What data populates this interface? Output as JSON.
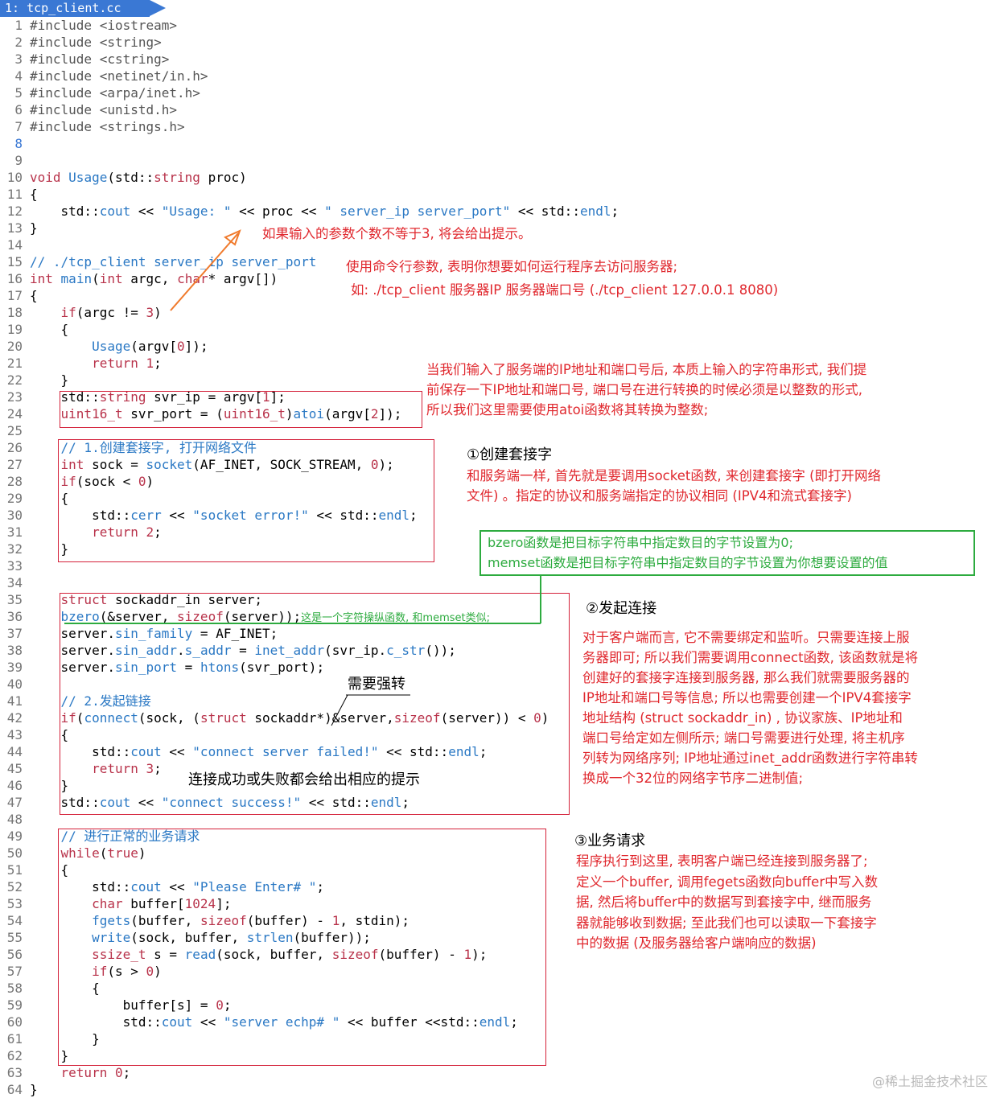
{
  "tab": {
    "label": "1: tcp_client.cc"
  },
  "code_lines": [
    {
      "n": "1",
      "html": "<span class='pp'>#include &lt;iostream&gt;</span>"
    },
    {
      "n": "2",
      "html": "<span class='pp'>#include &lt;string&gt;</span>"
    },
    {
      "n": "3",
      "html": "<span class='pp'>#include &lt;cstring&gt;</span>"
    },
    {
      "n": "4",
      "html": "<span class='pp'>#include &lt;netinet/in.h&gt;</span>"
    },
    {
      "n": "5",
      "html": "<span class='pp'>#include &lt;arpa/inet.h&gt;</span>"
    },
    {
      "n": "6",
      "html": "<span class='pp'>#include &lt;unistd.h&gt;</span>"
    },
    {
      "n": "7",
      "html": "<span class='pp'>#include &lt;strings.h&gt;</span>"
    },
    {
      "n": "8",
      "html": "",
      "current": true
    },
    {
      "n": "9",
      "html": ""
    },
    {
      "n": "10",
      "html": "<span class='ty'>void</span> <span class='fn'>Usage</span>(std::<span class='ty'>string</span> proc)"
    },
    {
      "n": "11",
      "html": "{"
    },
    {
      "n": "12",
      "html": "    std::<span class='fn'>cout</span> &lt;&lt; <span class='str'>\"Usage: \"</span> &lt;&lt; proc &lt;&lt; <span class='str'>\" server_ip server_port\"</span> &lt;&lt; std::<span class='fn'>endl</span>;"
    },
    {
      "n": "13",
      "html": "}"
    },
    {
      "n": "14",
      "html": ""
    },
    {
      "n": "15",
      "html": "<span class='cm'>// ./tcp_client server_ip server_port</span>"
    },
    {
      "n": "16",
      "html": "<span class='ty'>int</span> <span class='fn'>main</span>(<span class='ty'>int</span> argc, <span class='ty'>char</span>* argv[])"
    },
    {
      "n": "17",
      "html": "{"
    },
    {
      "n": "18",
      "html": "    <span class='kw'>if</span>(argc != <span class='num'>3</span>)"
    },
    {
      "n": "19",
      "html": "    {"
    },
    {
      "n": "20",
      "html": "        <span class='fn'>Usage</span>(argv[<span class='num'>0</span>]);"
    },
    {
      "n": "21",
      "html": "        <span class='kw'>return</span> <span class='num'>1</span>;"
    },
    {
      "n": "22",
      "html": "    }"
    },
    {
      "n": "23",
      "html": "    std::<span class='ty'>string</span> svr_ip = argv[<span class='num'>1</span>];"
    },
    {
      "n": "24",
      "html": "    <span class='ty'>uint16_t</span> svr_port = (<span class='ty'>uint16_t</span>)<span class='fn'>atoi</span>(argv[<span class='num'>2</span>]);"
    },
    {
      "n": "25",
      "html": ""
    },
    {
      "n": "26",
      "html": "    <span class='cm'>// 1.创建套接字, 打开网络文件</span>"
    },
    {
      "n": "27",
      "html": "    <span class='ty'>int</span> sock = <span class='fn'>socket</span>(AF_INET, SOCK_STREAM, <span class='num'>0</span>);"
    },
    {
      "n": "28",
      "html": "    <span class='kw'>if</span>(sock &lt; <span class='num'>0</span>)"
    },
    {
      "n": "29",
      "html": "    {"
    },
    {
      "n": "30",
      "html": "        std::<span class='fn'>cerr</span> &lt;&lt; <span class='str'>\"socket error!\"</span> &lt;&lt; std::<span class='fn'>endl</span>;"
    },
    {
      "n": "31",
      "html": "        <span class='kw'>return</span> <span class='num'>2</span>;"
    },
    {
      "n": "32",
      "html": "    }"
    },
    {
      "n": "33",
      "html": ""
    },
    {
      "n": "34",
      "html": ""
    },
    {
      "n": "35",
      "html": "    <span class='kw'>struct</span> sockaddr_in server;"
    },
    {
      "n": "36",
      "html": "    <span class='fn'>bzero</span>(&amp;server, <span class='kw'>sizeof</span>(server));<span class='note-green-inline' style='color:#2dab3f;font-family:\"DejaVu Sans\",sans-serif;font-size:13px;'>这是一个字符操纵函数, 和memset类似;</span>"
    },
    {
      "n": "37",
      "html": "    server.<span class='fn'>sin_family</span> = AF_INET;"
    },
    {
      "n": "38",
      "html": "    server.<span class='fn'>sin_addr</span>.<span class='fn'>s_addr</span> = <span class='fn'>inet_addr</span>(svr_ip.<span class='fn'>c_str</span>());"
    },
    {
      "n": "39",
      "html": "    server.<span class='fn'>sin_port</span> = <span class='fn'>htons</span>(svr_port);"
    },
    {
      "n": "40",
      "html": ""
    },
    {
      "n": "41",
      "html": "    <span class='cm'>// 2.发起链接</span>"
    },
    {
      "n": "42",
      "html": "    <span class='kw'>if</span>(<span class='fn'>connect</span>(sock, (<span class='kw'>struct</span> sockaddr*)&amp;server,<span class='kw'>sizeof</span>(server)) &lt; <span class='num'>0</span>)"
    },
    {
      "n": "43",
      "html": "    {"
    },
    {
      "n": "44",
      "html": "        std::<span class='fn'>cout</span> &lt;&lt; <span class='str'>\"connect server failed!\"</span> &lt;&lt; std::<span class='fn'>endl</span>;"
    },
    {
      "n": "45",
      "html": "        <span class='kw'>return</span> <span class='num'>3</span>;"
    },
    {
      "n": "46",
      "html": "    }"
    },
    {
      "n": "47",
      "html": "    std::<span class='fn'>cout</span> &lt;&lt; <span class='str'>\"connect success!\"</span> &lt;&lt; std::<span class='fn'>endl</span>;"
    },
    {
      "n": "48",
      "html": ""
    },
    {
      "n": "49",
      "html": "    <span class='cm'>// 进行正常的业务请求</span>"
    },
    {
      "n": "50",
      "html": "    <span class='kw'>while</span>(<span class='kw'>true</span>)"
    },
    {
      "n": "51",
      "html": "    {"
    },
    {
      "n": "52",
      "html": "        std::<span class='fn'>cout</span> &lt;&lt; <span class='str'>\"Please Enter# \"</span>;"
    },
    {
      "n": "53",
      "html": "        <span class='ty'>char</span> buffer[<span class='num'>1024</span>];"
    },
    {
      "n": "54",
      "html": "        <span class='fn'>fgets</span>(buffer, <span class='kw'>sizeof</span>(buffer) - <span class='num'>1</span>, stdin);"
    },
    {
      "n": "55",
      "html": "        <span class='fn'>write</span>(sock, buffer, <span class='fn'>strlen</span>(buffer));"
    },
    {
      "n": "56",
      "html": "        <span class='ty'>ssize_t</span> s = <span class='fn'>read</span>(sock, buffer, <span class='kw'>sizeof</span>(buffer) - <span class='num'>1</span>);"
    },
    {
      "n": "57",
      "html": "        <span class='kw'>if</span>(s &gt; <span class='num'>0</span>)"
    },
    {
      "n": "58",
      "html": "        {"
    },
    {
      "n": "59",
      "html": "            buffer[s] = <span class='num'>0</span>;"
    },
    {
      "n": "60",
      "html": "            std::<span class='fn'>cout</span> &lt;&lt; <span class='str'>\"server echp# \"</span> &lt;&lt; buffer &lt;&lt;std::<span class='fn'>endl</span>;"
    },
    {
      "n": "61",
      "html": "        }"
    },
    {
      "n": "62",
      "html": "    }"
    },
    {
      "n": "63",
      "html": "    <span class='kw'>return</span> <span class='num'>0</span>;"
    },
    {
      "n": "64",
      "html": "}"
    }
  ],
  "annotations": {
    "usage_hint": "如果输入的参数个数不等于3, 将会给出提示。",
    "cmdline_hint_1": "使用命令行参数, 表明你想要如何运行程序去访问服务器;",
    "cmdline_hint_2": "如: ./tcp_client 服务器IP 服务器端口号 (./tcp_client 127.0.0.1 8080)",
    "convert_hint_1": "当我们输入了服务端的IP地址和端口号后, 本质上输入的字符串形式, 我们提",
    "convert_hint_2": "前保存一下IP地址和端口号, 端口号在进行转换的时候必须是以整数的形式,",
    "convert_hint_3": "所以我们这里需要使用atoi函数将其转换为整数;",
    "socket_title": "①创建套接字",
    "socket_desc_1": "和服务端一样, 首先就是要调用socket函数, 来创建套接字 (即打开网络",
    "socket_desc_2": "文件) 。指定的协议和服务端指定的协议相同 (IPV4和流式套接字)",
    "bzero_note_1": "bzero函数是把目标字符串中指定数目的字节设置为0;",
    "bzero_note_2": "memset函数是把目标字符串中指定数目的字节设置为你想要设置的值",
    "connect_title": "②发起连接",
    "connect_desc": [
      "对于客户端而言, 它不需要绑定和监听。只需要连接上服",
      "务器即可; 所以我们需要调用connect函数, 该函数就是将",
      "创建好的套接字连接到服务器, 那么我们就需要服务器的",
      "IP地址和端口号等信息; 所以也需要创建一个IPV4套接字",
      "地址结构 (struct sockaddr_in) , 协议家族、IP地址和",
      "端口号给定如左侧所示; 端口号需要进行处理, 将主机序",
      "列转为网络序列; IP地址通过inet_addr函数进行字符串转",
      "换成一个32位的网络字节序二进制值;"
    ],
    "cast_note": "需要强转",
    "connect_result": "连接成功或失败都会给出相应的提示",
    "request_title": "③业务请求",
    "request_desc": [
      "程序执行到这里, 表明客户端已经连接到服务器了;",
      "定义一个buffer, 调用fegets函数向buffer中写入数",
      "据, 然后将buffer中的数据写到套接字中, 继而服务",
      "器就能够收到数据; 至此我们也可以读取一下套接字",
      "中的数据 (及服务器给客户端响应的数据)"
    ]
  },
  "watermark": "@稀土掘金技术社区",
  "colors": {
    "accent": "#3a78d4",
    "annotation_red": "#e0282e",
    "annotation_green": "#2dab3f",
    "box_red": "#d4213a"
  }
}
